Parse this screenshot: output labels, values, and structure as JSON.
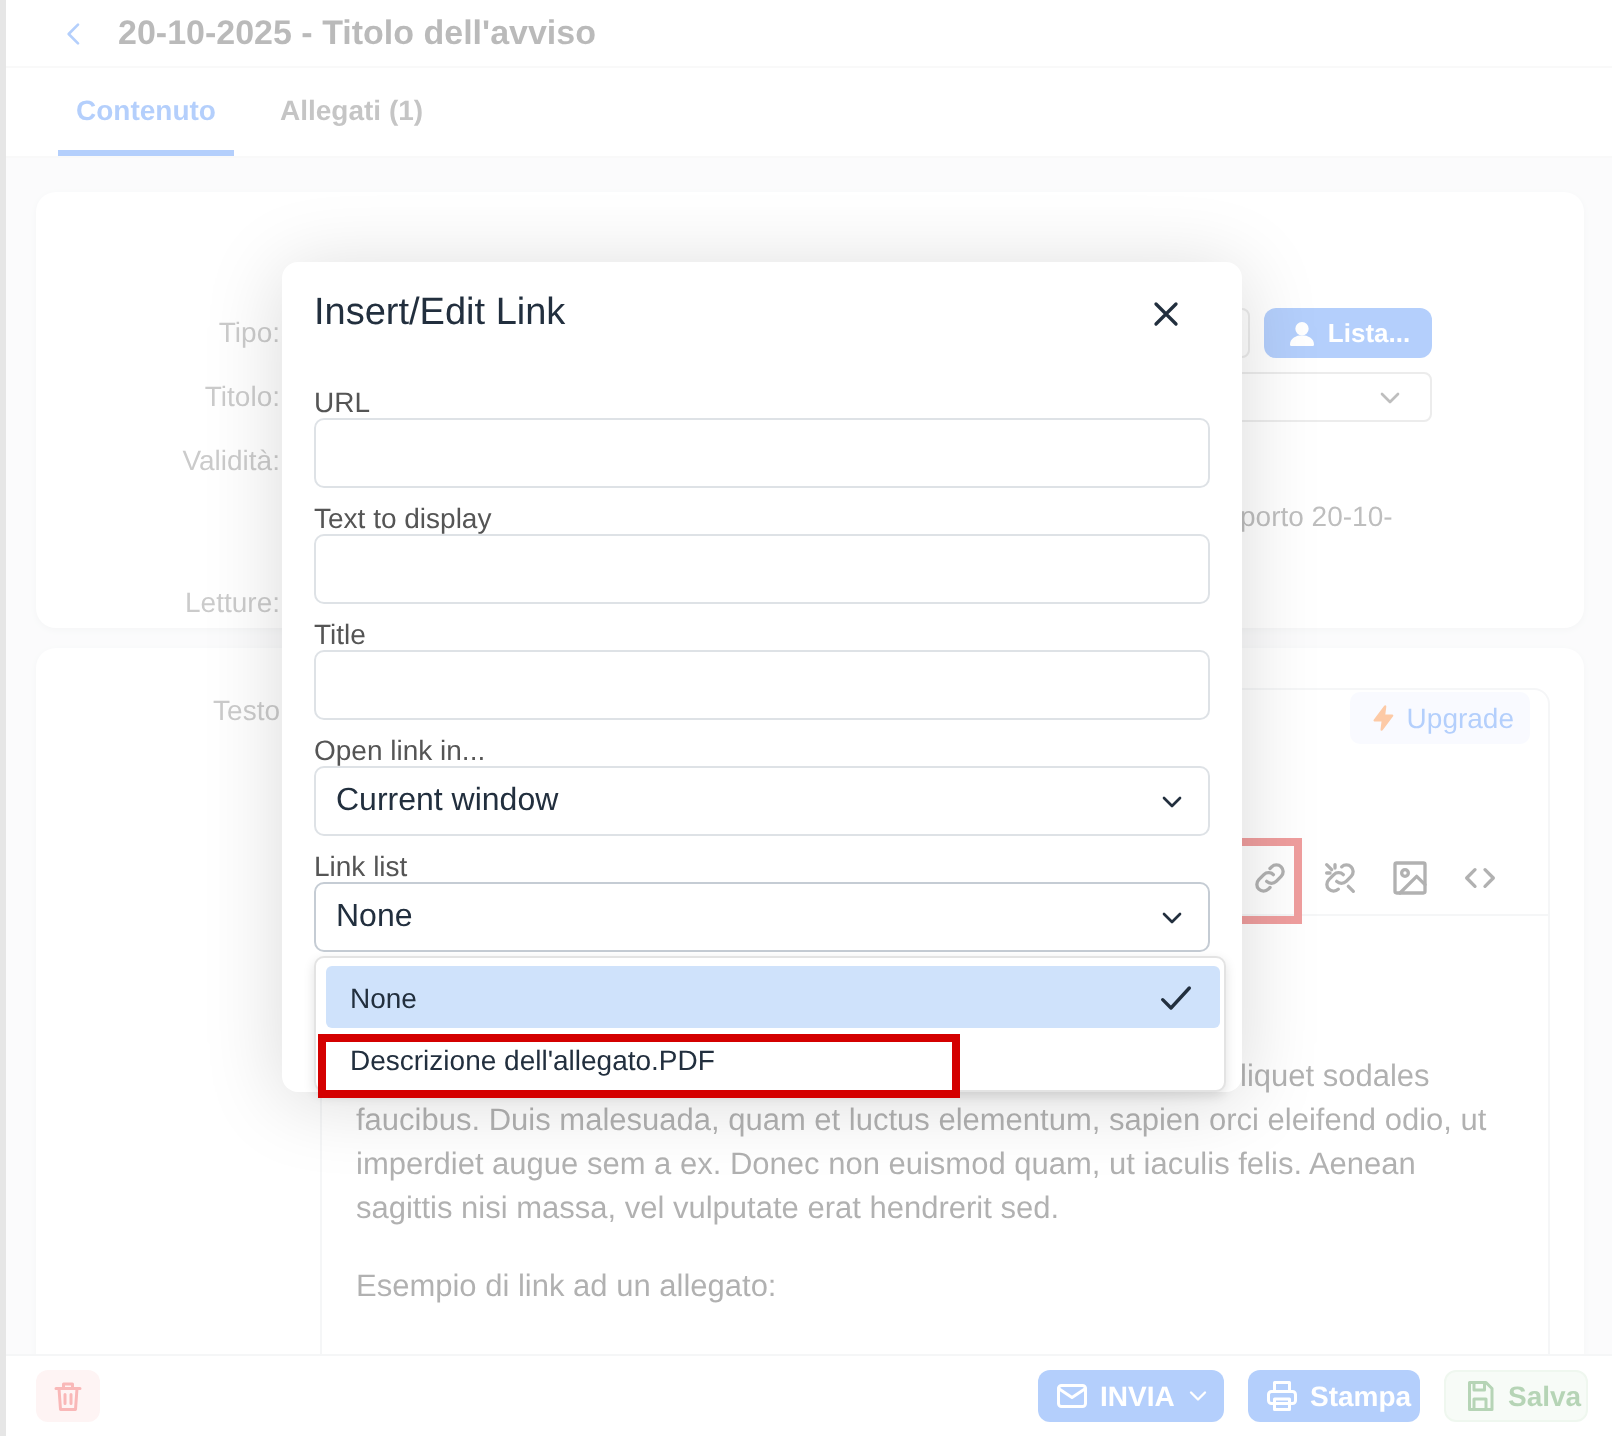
{
  "header": {
    "title": "20-10-2025 - Titolo dell'avviso"
  },
  "tabs": [
    {
      "label": "Contenuto",
      "selected": true
    },
    {
      "label": "Allegati (1)",
      "selected": false
    }
  ],
  "form": {
    "labels": [
      "Tipo:",
      "Titolo:",
      "Validità:",
      "Letture:"
    ],
    "list_button": "Lista...",
    "validity_text": "porto 20-10-"
  },
  "editor": {
    "label": "Testo",
    "upgrade_button": "Upgrade",
    "toolbar": [
      {
        "kind": "link",
        "highlighted": true
      },
      {
        "kind": "unlink",
        "highlighted": false
      },
      {
        "kind": "image",
        "highlighted": false
      },
      {
        "kind": "code",
        "highlighted": false
      }
    ],
    "first_line_end": "liquet sodales",
    "lines": [
      "faucibus. Duis malesuada, quam et luctus elementum, sapien orci eleifend odio, ut",
      "imperdiet augue sem a ex. Donec non euismod quam, ut iaculis felis. Aenean",
      "sagittis nisi massa, vel vulputate erat hendrerit sed."
    ],
    "paragraph": "Esempio di link ad un allegato:"
  },
  "footer": {
    "buttons": [
      {
        "kind": "delete"
      },
      {
        "kind": "send",
        "label": "INVIA"
      },
      {
        "kind": "print",
        "label": "Stampa"
      },
      {
        "kind": "save",
        "label": "Salva"
      }
    ]
  },
  "dialog": {
    "title": "Insert/Edit Link",
    "fields": [
      {
        "label": "URL",
        "kind": "text"
      },
      {
        "label": "Text to display",
        "kind": "text"
      },
      {
        "label": "Title",
        "kind": "text"
      },
      {
        "label": "Open link in...",
        "kind": "select",
        "value": "Current window"
      },
      {
        "label": "Link list",
        "kind": "select",
        "value": "None",
        "expanded": true
      }
    ],
    "options": [
      {
        "label": "None",
        "selected": true,
        "highlighted": false
      },
      {
        "label": "Descrizione dell'allegato.PDF",
        "selected": false,
        "highlighted": true
      }
    ]
  }
}
